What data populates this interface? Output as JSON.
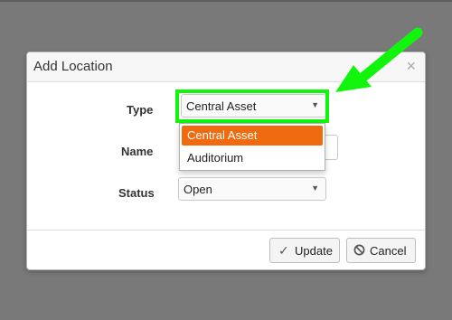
{
  "dialog": {
    "title": "Add Location",
    "close_symbol": "×"
  },
  "form": {
    "type_label": "Type",
    "type_value": "Central Asset",
    "name_label": "Name",
    "name_value": "",
    "status_label": "Status",
    "status_value": "Open"
  },
  "dropdown": {
    "options": [
      "Central Asset",
      "Auditorium"
    ],
    "selected_index": 0
  },
  "buttons": {
    "update_label": "Update",
    "cancel_label": "Cancel"
  },
  "icons": {
    "dropdown_arrow": "caret-down-icon",
    "update": "check-icon",
    "cancel": "ban-icon",
    "annotation": "arrow-icon"
  },
  "colors": {
    "highlight": "#11f50c",
    "selected_option": "#f06a0f",
    "backdrop": "#797979"
  }
}
